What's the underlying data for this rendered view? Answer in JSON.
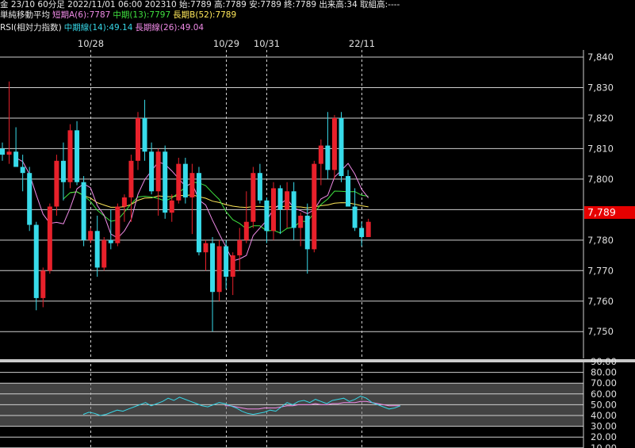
{
  "header": {
    "line1": "金 23/10 60分足 2022/11/01 06:00 202310 始:7789 高:7789 安:7789 終:7789 出来高:34 取組高:----",
    "line2": {
      "label": "単純移動平均",
      "short": "短期A(6):7787",
      "mid": "中期(13):7797",
      "long": "長期B(52):7789"
    },
    "line3": {
      "label": "RSI(相対力指数)",
      "mid": "中期線(14):49.14",
      "long": "長期線(26):49.04"
    }
  },
  "current_price_label": "7,789",
  "colors": {
    "up": "#e8212b",
    "down": "#38dbea",
    "ma_short": "#ef8ae6",
    "ma_mid": "#3fe03f",
    "ma_long": "#ffe85a",
    "rsi_mid": "#36d6e6",
    "rsi_long": "#ef8ae6",
    "price_box": "#e60000"
  },
  "chart_data": [
    {
      "type": "candlestick",
      "date_labels": [
        "10/28",
        "10/29",
        "10/31",
        "22/11"
      ],
      "y_ticks": [
        "7,840",
        "7,830",
        "7,820",
        "7,810",
        "7,800",
        "7,790",
        "7,780",
        "7,770",
        "7,760",
        "7,750"
      ],
      "ylim": [
        7746,
        7842
      ],
      "grid": true,
      "candles": [
        [
          7810,
          7812,
          7806,
          7808
        ],
        [
          7808,
          7832,
          7805,
          7809
        ],
        [
          7809,
          7817,
          7805,
          7804
        ],
        [
          7804,
          7808,
          7796,
          7802
        ],
        [
          7802,
          7804,
          7783,
          7785
        ],
        [
          7785,
          7786,
          7757,
          7761
        ],
        [
          7761,
          7771,
          7758,
          7770
        ],
        [
          7770,
          7792,
          7769,
          7791
        ],
        [
          7791,
          7808,
          7788,
          7806
        ],
        [
          7806,
          7812,
          7793,
          7799
        ],
        [
          7799,
          7818,
          7797,
          7816
        ],
        [
          7816,
          7819,
          7798,
          7799
        ],
        [
          7799,
          7801,
          7778,
          7780
        ],
        [
          7780,
          7784,
          7779,
          7783
        ],
        [
          7783,
          7788,
          7768,
          7771
        ],
        [
          7771,
          7781,
          7770,
          7780
        ],
        [
          7780,
          7790,
          7777,
          7779
        ],
        [
          7779,
          7792,
          7778,
          7791
        ],
        [
          7791,
          7795,
          7786,
          7794
        ],
        [
          7794,
          7808,
          7786,
          7806
        ],
        [
          7806,
          7822,
          7803,
          7820
        ],
        [
          7820,
          7826,
          7806,
          7809
        ],
        [
          7809,
          7812,
          7795,
          7796
        ],
        [
          7796,
          7810,
          7788,
          7809
        ],
        [
          7809,
          7811,
          7787,
          7789
        ],
        [
          7789,
          7795,
          7786,
          7793
        ],
        [
          7793,
          7807,
          7792,
          7805
        ],
        [
          7805,
          7807,
          7792,
          7794
        ],
        [
          7794,
          7805,
          7782,
          7802
        ],
        [
          7802,
          7804,
          7775,
          7776
        ],
        [
          7776,
          7780,
          7770,
          7779
        ],
        [
          7779,
          7781,
          7750,
          7763
        ],
        [
          7763,
          7780,
          7760,
          7778
        ],
        [
          7778,
          7780,
          7764,
          7768
        ],
        [
          7768,
          7776,
          7762,
          7775
        ],
        [
          7775,
          7784,
          7770,
          7780
        ],
        [
          7780,
          7796,
          7779,
          7786
        ],
        [
          7786,
          7804,
          7784,
          7802
        ],
        [
          7802,
          7805,
          7792,
          7793
        ],
        [
          7793,
          7794,
          7779,
          7783
        ],
        [
          7783,
          7799,
          7780,
          7797
        ],
        [
          7797,
          7798,
          7782,
          7790
        ],
        [
          7790,
          7799,
          7784,
          7796
        ],
        [
          7796,
          7799,
          7780,
          7784
        ],
        [
          7784,
          7789,
          7778,
          7788
        ],
        [
          7788,
          7792,
          7769,
          7777
        ],
        [
          7777,
          7806,
          7776,
          7805
        ],
        [
          7805,
          7813,
          7798,
          7811
        ],
        [
          7811,
          7822,
          7800,
          7803
        ],
        [
          7803,
          7821,
          7800,
          7820
        ],
        [
          7820,
          7822,
          7799,
          7801
        ],
        [
          7801,
          7803,
          7791,
          7791
        ],
        [
          7791,
          7797,
          7783,
          7784
        ],
        [
          7784,
          7786,
          7778,
          7781
        ],
        [
          7781,
          7787,
          7781,
          7786
        ]
      ],
      "ma_short_label": "短期A(6)",
      "ma_mid_label": "中期(13)",
      "ma_long_label": "長期B(52)"
    },
    {
      "type": "line",
      "title": "RSI(相対力指数)",
      "y_ticks": [
        "90.00",
        "80.00",
        "70.00",
        "60.00",
        "50.00",
        "40.00",
        "30.00",
        "20.00",
        "10.00"
      ],
      "ylim": [
        10,
        90
      ],
      "shaded_band": [
        30,
        70
      ],
      "series": [
        {
          "name": "中期線(14)",
          "values": [
            41,
            43,
            42,
            40,
            41,
            43,
            45,
            44,
            46,
            48,
            50,
            52,
            49,
            51,
            53,
            56,
            54,
            57,
            55,
            53,
            51,
            49,
            48,
            50,
            52,
            51,
            49,
            47,
            44,
            42,
            41,
            42,
            43,
            45,
            44,
            48,
            52,
            50,
            53,
            54,
            52,
            55,
            53,
            51,
            54,
            55,
            56,
            53,
            55,
            58,
            56,
            52,
            50,
            48,
            46,
            47,
            49
          ]
        },
        {
          "name": "長期線(26)",
          "values": [
            null,
            null,
            null,
            null,
            null,
            null,
            null,
            null,
            null,
            null,
            null,
            null,
            null,
            null,
            null,
            null,
            null,
            null,
            null,
            null,
            null,
            null,
            null,
            null,
            null,
            49,
            49,
            48,
            47,
            46,
            46,
            46,
            47,
            47,
            47,
            48,
            49,
            49,
            50,
            50,
            50,
            51,
            50,
            50,
            51,
            51,
            52,
            52,
            52,
            53,
            53,
            52,
            51,
            50,
            49,
            49,
            49
          ]
        }
      ]
    }
  ]
}
